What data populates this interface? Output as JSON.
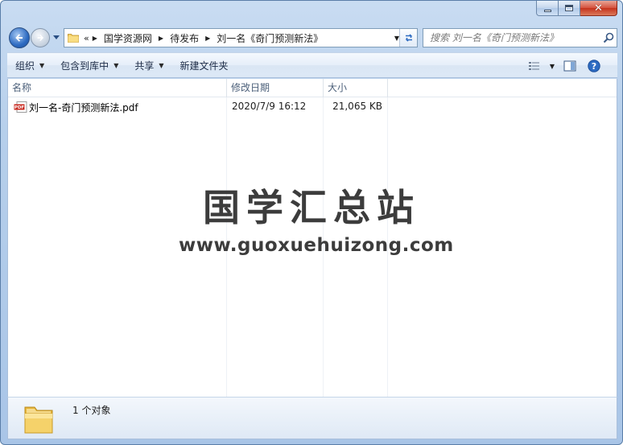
{
  "window": {
    "minimize_icon": "minimize-icon",
    "maximize_icon": "maximize-icon",
    "close_icon": "close-icon"
  },
  "nav": {
    "back_icon": "back-arrow-icon",
    "forward_icon": "forward-arrow-icon",
    "overflow": "«",
    "breadcrumbs": [
      "国学资源网",
      "待发布",
      "刘一名《奇门预测新法》"
    ]
  },
  "search": {
    "placeholder": "搜索 刘一名《奇门预测新法》"
  },
  "toolbar": {
    "organize": "组织",
    "include_in_library": "包含到库中",
    "share": "共享",
    "new_folder": "新建文件夹"
  },
  "columns": {
    "name": "名称",
    "date": "修改日期",
    "size": "大小"
  },
  "files": [
    {
      "name": "刘一名-奇门预测新法.pdf",
      "date": "2020/7/9 16:12",
      "size": "21,065 KB",
      "icon": "pdf-file-icon"
    }
  ],
  "watermark": {
    "title": "国学汇总站",
    "url": "www.guoxuehuizong.com"
  },
  "details": {
    "count_text": "1 个对象"
  },
  "colors": {
    "accent": "#2d6bc2",
    "chrome": "#b6cfeb",
    "close": "#c4321c"
  }
}
